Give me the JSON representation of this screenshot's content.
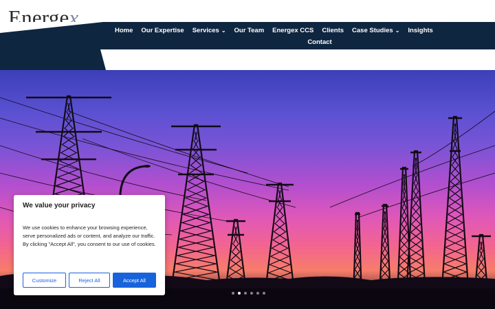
{
  "logo": {
    "text_main": "Energe",
    "text_accent": "x"
  },
  "nav": {
    "items": [
      {
        "label": "Home",
        "dropdown": false
      },
      {
        "label": "Our Expertise",
        "dropdown": false
      },
      {
        "label": "Services",
        "dropdown": true
      },
      {
        "label": "Our Team",
        "dropdown": false
      },
      {
        "label": "Energex CCS",
        "dropdown": false
      },
      {
        "label": "Clients",
        "dropdown": false
      },
      {
        "label": "Case Studies",
        "dropdown": true
      },
      {
        "label": "Insights",
        "dropdown": false
      }
    ],
    "contact": "Contact"
  },
  "hero": {
    "slides": 6,
    "active": 1
  },
  "cookie": {
    "title": "We value your privacy",
    "body": "We use cookies to enhance your browsing experience, serve personalized ads or content, and analyze our traffic. By clicking \"Accept All\", you consent to our use of cookies.",
    "buttons": {
      "customize": "Customize",
      "reject": "Reject All",
      "accept": "Accept All"
    }
  },
  "colors": {
    "nav_bg": "#0f2640",
    "accent": "#1863dc"
  }
}
